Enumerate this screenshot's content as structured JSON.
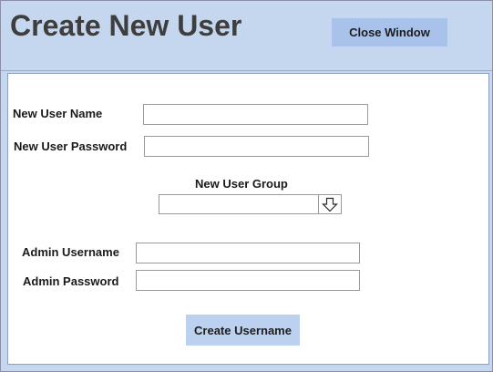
{
  "header": {
    "title": "Create New User",
    "close_button_label": "Close Window"
  },
  "form": {
    "new_user_name": {
      "label": "New User Name",
      "value": ""
    },
    "new_user_password": {
      "label": "New User Password",
      "value": ""
    },
    "new_user_group": {
      "label": "New User Group",
      "selected": "",
      "icon": "down-arrow-icon"
    },
    "admin_username": {
      "label": "Admin Username",
      "value": ""
    },
    "admin_password": {
      "label": "Admin Password",
      "value": ""
    },
    "submit_label": "Create Username"
  },
  "colors": {
    "header_background": "#c5d6ef",
    "button_background": "#a9c2ea",
    "panel_background": "#ffffff",
    "title_text": "#3e3e3e"
  }
}
